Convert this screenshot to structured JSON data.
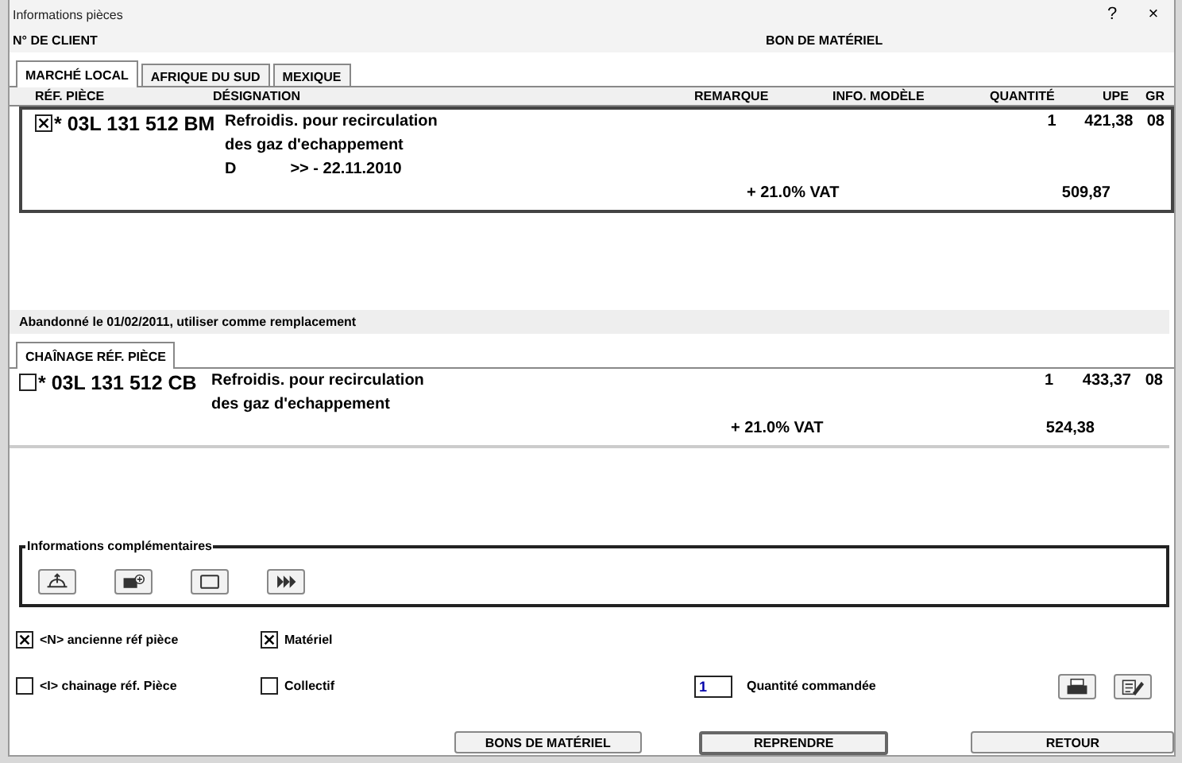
{
  "window": {
    "title": "Informations pièces",
    "help": "?",
    "close": "×"
  },
  "header": {
    "client_label": "N° DE CLIENT",
    "order_label": "BON DE MATÉRIEL"
  },
  "tabs": [
    {
      "label": "MARCHÉ LOCAL",
      "selected": true
    },
    {
      "label": "AFRIQUE DU SUD",
      "selected": false
    },
    {
      "label": "MEXIQUE",
      "selected": false
    }
  ],
  "table": {
    "columns": [
      "RÉF. PIÈCE",
      "DÉSIGNATION",
      "REMARQUE",
      "INFO. MODÈLE",
      "QUANTITÉ",
      "UPE",
      "GR"
    ],
    "rows": [
      {
        "checked": true,
        "ref": "* 03L 131 512 BM",
        "designation": [
          "Refroidis. pour recirculation",
          "des gaz d'echappement"
        ],
        "extra": [
          "D",
          ">> - 22.11.2010"
        ],
        "quantity": "1",
        "upe": "421,38",
        "gr": "08",
        "vat_label": "+ 21.0% VAT",
        "vat_total": "509,87"
      }
    ]
  },
  "notice": "Abandonné le 01/02/2011, utiliser comme remplacement",
  "chain_tabs": [
    {
      "label": "CHAÎNAGE RÉF. PIÈCE",
      "selected": true
    }
  ],
  "chain_rows": [
    {
      "checked": false,
      "ref": "* 03L 131 512 CB",
      "designation": [
        "Refroidis. pour recirculation",
        "des gaz d'echappement"
      ],
      "quantity": "1",
      "upe": "433,37",
      "gr": "08",
      "vat_label": "+ 21.0% VAT",
      "vat_total": "524,38"
    }
  ],
  "info_group": {
    "title": "Informations complémentaires",
    "buttons": [
      {
        "kind": "lift"
      },
      {
        "kind": "camera"
      },
      {
        "kind": "frame"
      },
      {
        "kind": "forward"
      }
    ]
  },
  "options": [
    {
      "label": "<N> ancienne réf pièce",
      "checked": true
    },
    {
      "label": "Matériel",
      "checked": true
    },
    {
      "label": "<I> chainage réf. Pièce",
      "checked": false
    },
    {
      "label": "Collectif",
      "checked": false
    }
  ],
  "quantity": {
    "value": "1",
    "label": "Quantité commandée"
  },
  "tools": [
    {
      "kind": "print"
    },
    {
      "kind": "edit"
    }
  ],
  "buttons": [
    {
      "label": "BONS DE MATÉRIEL",
      "default": false
    },
    {
      "label": "REPRENDRE",
      "default": true
    },
    {
      "label": "RETOUR",
      "default": false
    }
  ]
}
